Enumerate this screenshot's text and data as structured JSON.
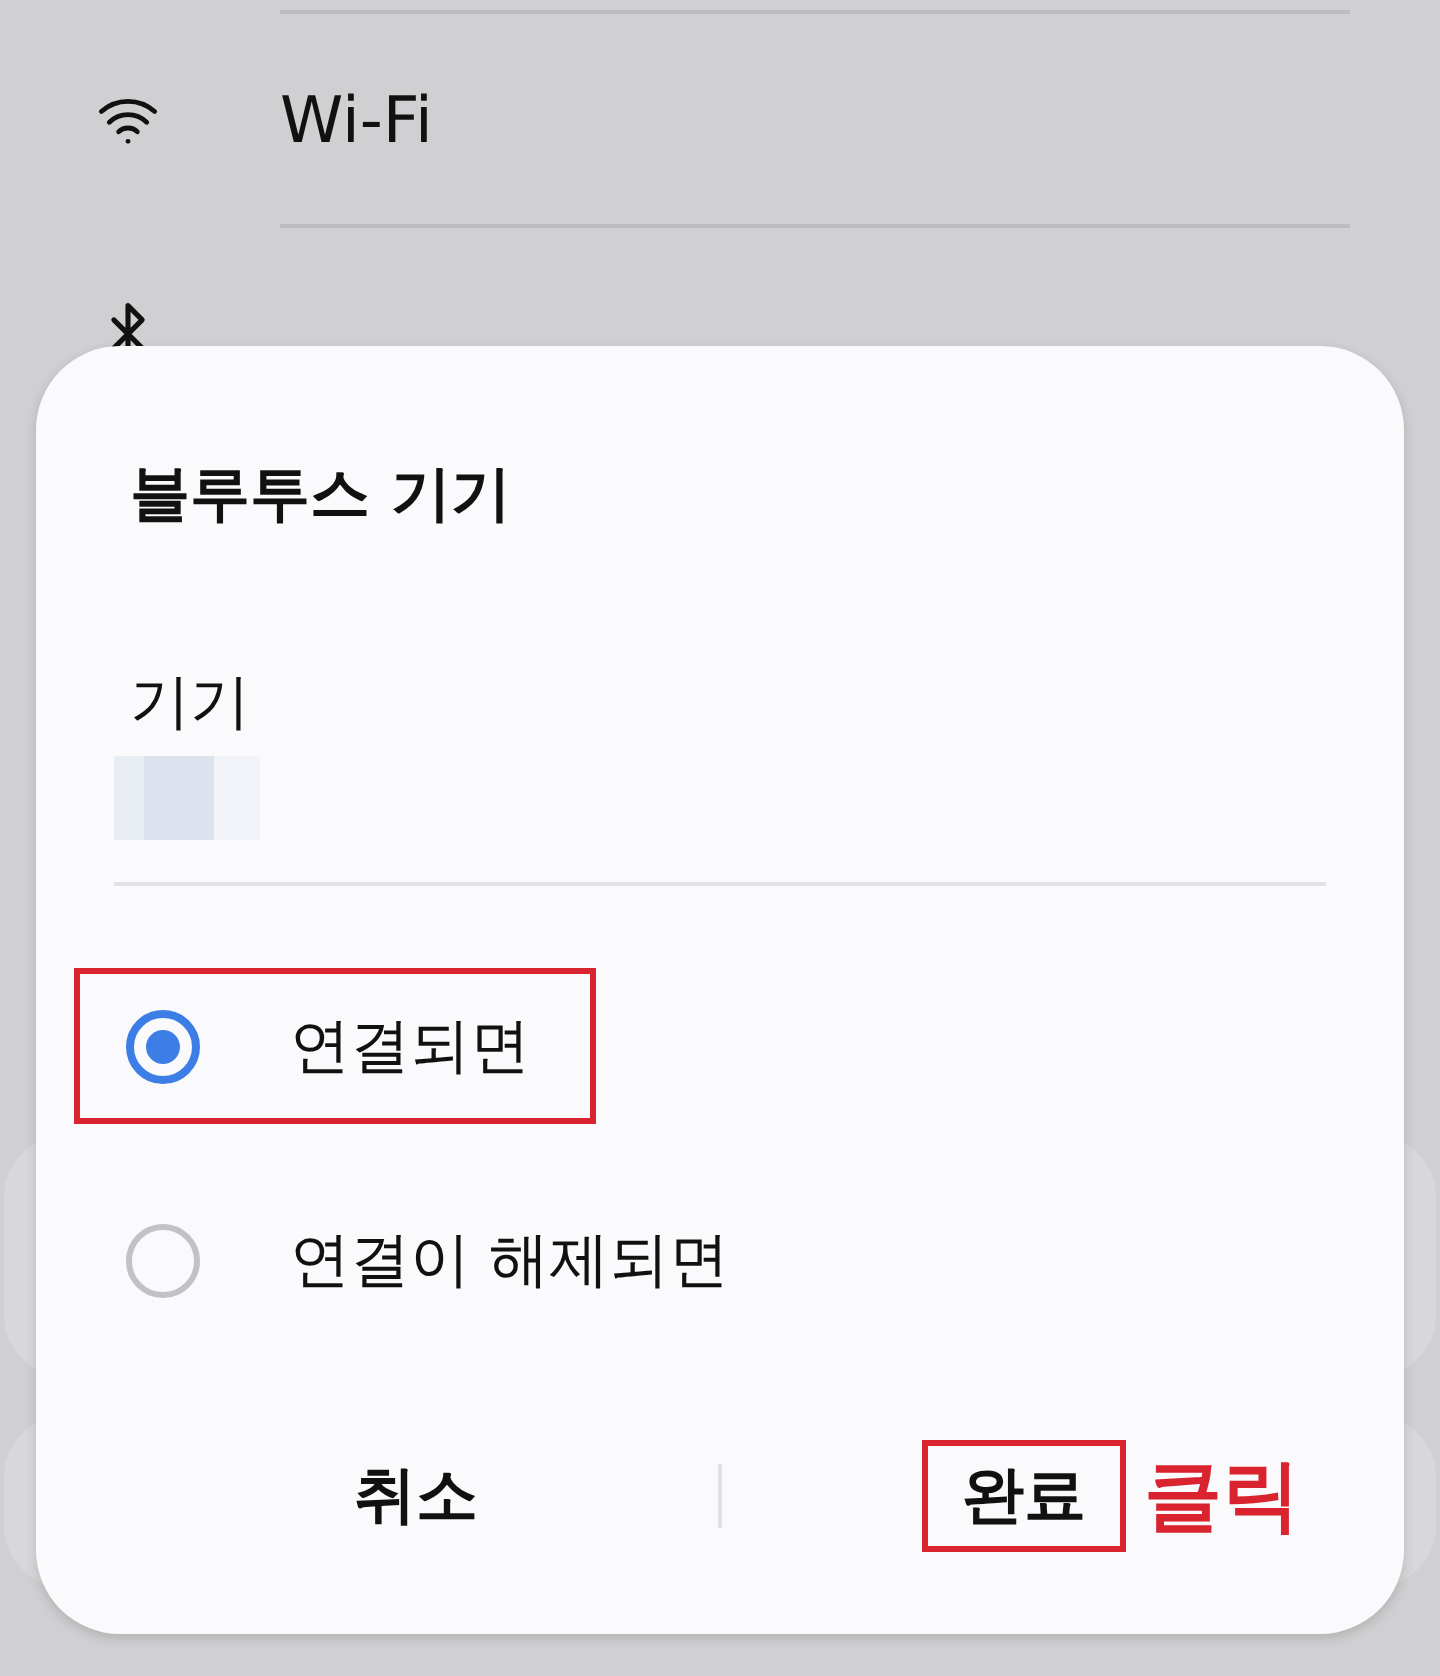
{
  "settings_list": {
    "items": [
      {
        "kind": "wifi",
        "label": "Wi-Fi"
      },
      {
        "kind": "bluetooth"
      }
    ]
  },
  "dialog": {
    "title": "블루투스 기기",
    "field": {
      "label": "기기"
    },
    "options": [
      {
        "label": "연결되면",
        "selected": true,
        "highlighted": true
      },
      {
        "label": "연결이 해제되면",
        "selected": false,
        "highlighted": false
      }
    ],
    "buttons": [
      {
        "label": "취소",
        "highlighted": false
      },
      {
        "label": "완료",
        "highlighted": true,
        "callout": "클릭"
      }
    ]
  }
}
